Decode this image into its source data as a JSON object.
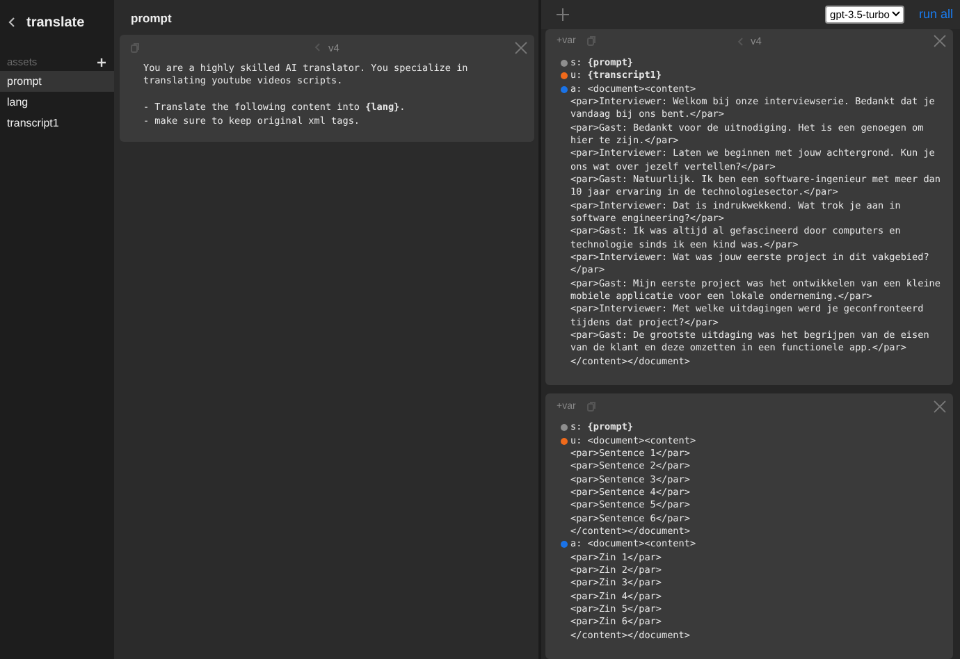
{
  "sidebar": {
    "title": "translate",
    "section": "assets",
    "items": [
      {
        "label": "prompt",
        "selected": true
      },
      {
        "label": "lang",
        "selected": false
      },
      {
        "label": "transcript1",
        "selected": false
      }
    ]
  },
  "editor": {
    "title": "prompt",
    "card": {
      "version": "v4",
      "paragraphs": [
        [
          "You are a highly skilled AI translator. You specialize in",
          "translating youtube videos scripts."
        ],
        [
          "- Translate the following content into **{lang}**.",
          "- make sure to keep original xml tags."
        ]
      ]
    }
  },
  "chat": {
    "model": "gpt-3.5-turbo",
    "run_label": "run all",
    "cards": [
      {
        "var_label": "+var",
        "version": "v4",
        "messages": [
          {
            "role": "s:",
            "color": "#8e8e8e",
            "lines": [
              "**{prompt}**"
            ]
          },
          {
            "role": "u:",
            "color": "#f06a1b",
            "lines": [
              "**{transcript1}**"
            ]
          },
          {
            "role": "a:",
            "color": "#1a73e8",
            "lines": [
              "<document><content>",
              "<par>Interviewer: Welkom bij onze interviewserie. Bedankt dat je",
              "vandaag bij ons bent.</par>",
              "<par>Gast: Bedankt voor de uitnodiging. Het is een genoegen om",
              "hier te zijn.</par>",
              "<par>Interviewer: Laten we beginnen met jouw achtergrond. Kun je",
              "ons wat over jezelf vertellen?</par>",
              "<par>Gast: Natuurlijk. Ik ben een software-ingenieur met meer dan",
              "10 jaar ervaring in de technologiesector.</par>",
              "<par>Interviewer: Dat is indrukwekkend. Wat trok je aan in",
              "software engineering?</par>",
              "<par>Gast: Ik was altijd al gefascineerd door computers en",
              "technologie sinds ik een kind was.</par>",
              "<par>Interviewer: Wat was jouw eerste project in dit vakgebied?",
              "</par>",
              "<par>Gast: Mijn eerste project was het ontwikkelen van een kleine",
              "mobiele applicatie voor een lokale onderneming.</par>",
              "<par>Interviewer: Met welke uitdagingen werd je geconfronteerd",
              "tijdens dat project?</par>",
              "<par>Gast: De grootste uitdaging was het begrijpen van de eisen",
              "van de klant en deze omzetten in een functionele app.</par>",
              "</content></document>"
            ]
          }
        ]
      },
      {
        "var_label": "+var",
        "messages": [
          {
            "role": "s:",
            "color": "#8e8e8e",
            "lines": [
              "**{prompt}**"
            ]
          },
          {
            "role": "u:",
            "color": "#f06a1b",
            "lines": [
              "<document><content>",
              "<par>Sentence 1</par>",
              "<par>Sentence 2</par>",
              "<par>Sentence 3</par>",
              "<par>Sentence 4</par>",
              "<par>Sentence 5</par>",
              "<par>Sentence 6</par>",
              "</content></document>"
            ]
          },
          {
            "role": "a:",
            "color": "#1a73e8",
            "lines": [
              "<document><content>",
              "<par>Zin 1</par>",
              "<par>Zin 2</par>",
              "<par>Zin 3</par>",
              "<par>Zin 4</par>",
              "<par>Zin 5</par>",
              "<par>Zin 6</par>",
              "</content></document>"
            ]
          }
        ]
      }
    ]
  }
}
